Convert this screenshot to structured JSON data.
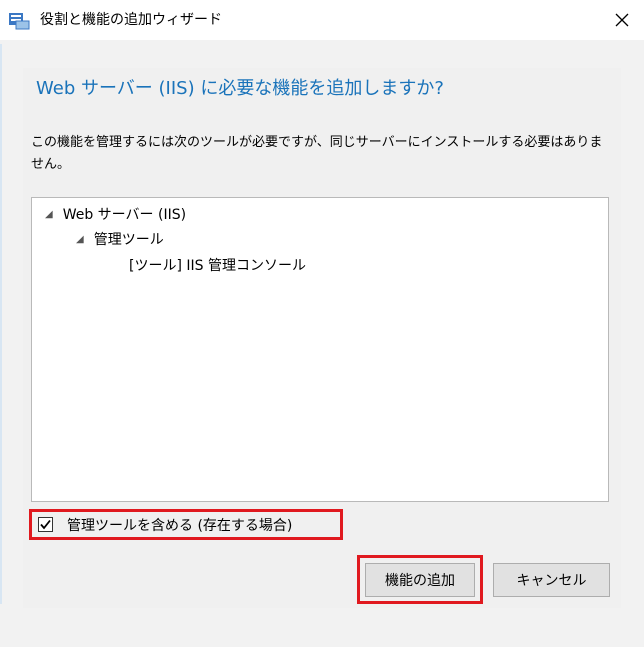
{
  "window": {
    "title": "役割と機能の追加ウィザード",
    "icon": "server-manager-icon"
  },
  "dialog": {
    "heading": "Web サーバー (IIS) に必要な機能を追加しますか?",
    "description": "この機能を管理するには次のツールが必要ですが、同じサーバーにインストールする必要はありません。",
    "tree": [
      {
        "label": "Web サーバー (IIS)",
        "level": 0,
        "expanded": true
      },
      {
        "label": "管理ツール",
        "level": 1,
        "expanded": true
      },
      {
        "label": "[ツール] IIS 管理コンソール",
        "level": 2,
        "expanded": false
      }
    ],
    "include_tools_checkbox": {
      "label": "管理ツールを含める (存在する場合)",
      "checked": true
    },
    "buttons": {
      "add": "機能の追加",
      "cancel": "キャンセル"
    }
  },
  "colors": {
    "heading": "#1a73ba",
    "highlight": "#e0191f"
  }
}
